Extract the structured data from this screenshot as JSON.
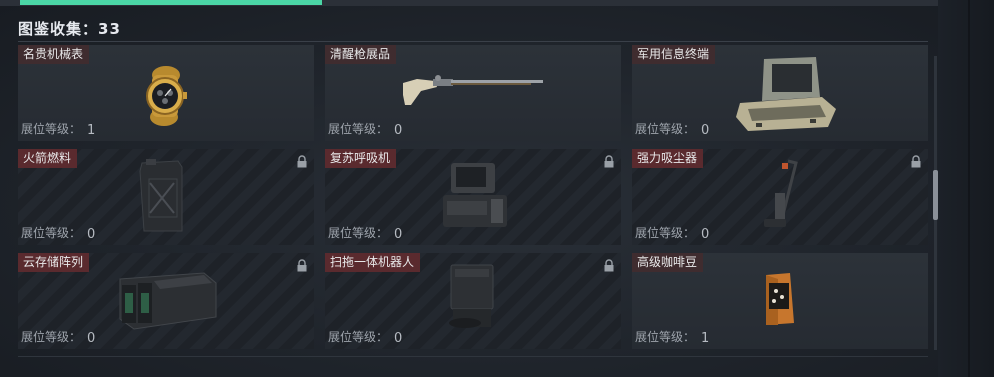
{
  "collection": {
    "title_label": "图鉴收集：",
    "count": "33"
  },
  "level_label": "展位等级：",
  "items": [
    {
      "name": "名贵机械表",
      "level": "1",
      "locked": false,
      "icon": "gold-watch-icon"
    },
    {
      "name": "清醒枪展品",
      "level": "0",
      "locked": false,
      "icon": "flintlock-rifle-icon"
    },
    {
      "name": "军用信息终端",
      "level": "0",
      "locked": false,
      "icon": "military-terminal-case-icon"
    },
    {
      "name": "火箭燃料",
      "level": "0",
      "locked": true,
      "icon": "fuel-canister-icon"
    },
    {
      "name": "复苏呼吸机",
      "level": "0",
      "locked": true,
      "icon": "ventilator-icon"
    },
    {
      "name": "强力吸尘器",
      "level": "0",
      "locked": true,
      "icon": "vacuum-cleaner-icon"
    },
    {
      "name": "云存储阵列",
      "level": "0",
      "locked": true,
      "icon": "storage-array-icon"
    },
    {
      "name": "扫拖一体机器人",
      "level": "0",
      "locked": true,
      "icon": "robot-vacuum-dock-icon"
    },
    {
      "name": "高级咖啡豆",
      "level": "1",
      "locked": false,
      "icon": "coffee-bag-icon"
    }
  ],
  "colors": {
    "accent": "#4bd6a6",
    "tag_locked": "#5a2a2e"
  }
}
